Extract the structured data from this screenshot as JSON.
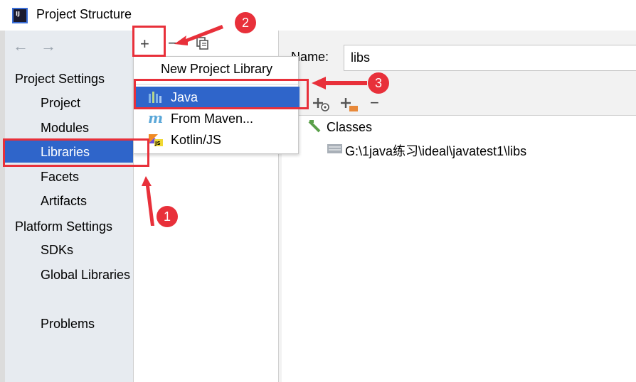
{
  "window": {
    "title": "Project Structure",
    "app_icon_label": "IJ"
  },
  "nav": {
    "back_icon": "arrow-left-icon",
    "forward_icon": "arrow-right-icon",
    "project_settings": {
      "heading": "Project Settings",
      "items": [
        "Project",
        "Modules",
        "Libraries",
        "Facets",
        "Artifacts"
      ]
    },
    "platform_settings": {
      "heading": "Platform Settings",
      "items": [
        "SDKs",
        "Global Libraries"
      ]
    },
    "problems": "Problems",
    "selected": "Libraries"
  },
  "toolbar": {
    "add_icon": "plus-icon",
    "remove_icon": "minus-icon",
    "copy_icon": "copy-icon"
  },
  "popup": {
    "title": "New Project Library",
    "items": [
      {
        "label": "Java",
        "icon": "java-library-icon",
        "selected": true
      },
      {
        "label": "From Maven...",
        "icon": "maven-icon",
        "selected": false
      },
      {
        "label": "Kotlin/JS",
        "icon": "kotlin-js-icon",
        "selected": false
      }
    ]
  },
  "detail": {
    "name_label": "Name:",
    "name_value": "libs",
    "classes_label": "Classes",
    "path": "G:\\1java练习\\ideal\\javatest1\\libs"
  },
  "annotations": {
    "badge_1": "1",
    "badge_2": "2",
    "badge_3": "3",
    "color": "#e8303a"
  },
  "colors": {
    "selection": "#2f65ca",
    "nav_bg": "#e7ebf0"
  }
}
